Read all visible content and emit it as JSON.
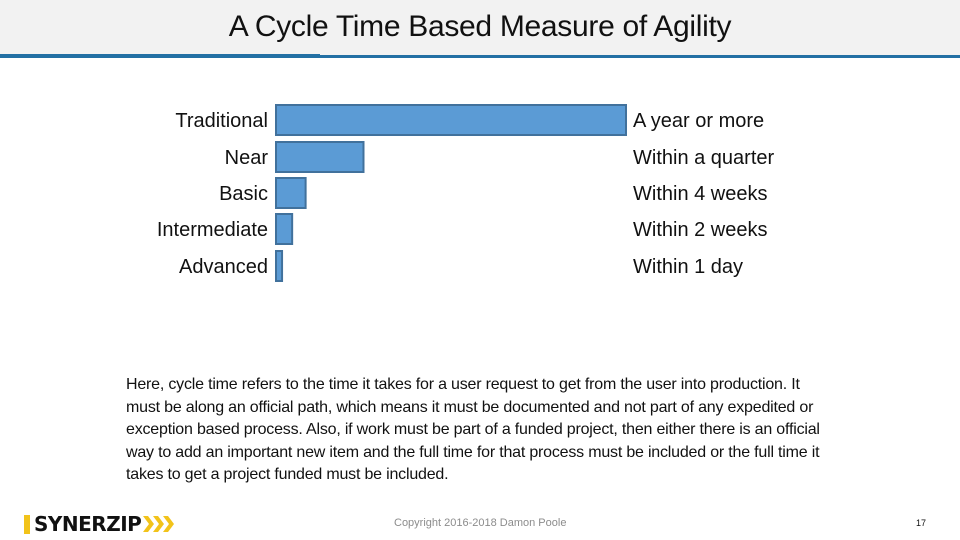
{
  "slide": {
    "title": "A Cycle Time Based Measure of Agility",
    "body": "Here, cycle time refers to the time it takes for a user request to get from the user into production. It must be along an official path, which means it must be documented and not part of any expedited or exception based process. Also, if work must be part of a funded project, then either there is an official way to add an important new item and the full time for that process must be included or the full time it takes to get a project funded must be included.",
    "logo_text": "SYNERZIP",
    "copyright": "Copyright 2016-2018 Damon Poole",
    "page_number": "17",
    "colors": {
      "accent": "#2370a4",
      "bar_fill": "#5b9bd5",
      "bar_stroke": "#41719c",
      "logo_yellow": "#f2c31a"
    }
  },
  "chart_data": {
    "type": "bar",
    "orientation": "horizontal",
    "title": "A Cycle Time Based Measure of Agility",
    "xlabel": "",
    "ylabel": "",
    "unit": "weeks (approx.)",
    "categories": [
      "Traditional",
      "Near",
      "Basic",
      "Intermediate",
      "Advanced"
    ],
    "values": [
      52,
      13,
      4.4,
      2.4,
      0.9
    ],
    "value_labels": [
      "A year or more",
      "Within a quarter",
      "Within 4 weeks",
      "Within 2 weeks",
      "Within 1 day"
    ],
    "xlim": [
      0,
      52
    ],
    "grid": false,
    "legend": "none"
  }
}
